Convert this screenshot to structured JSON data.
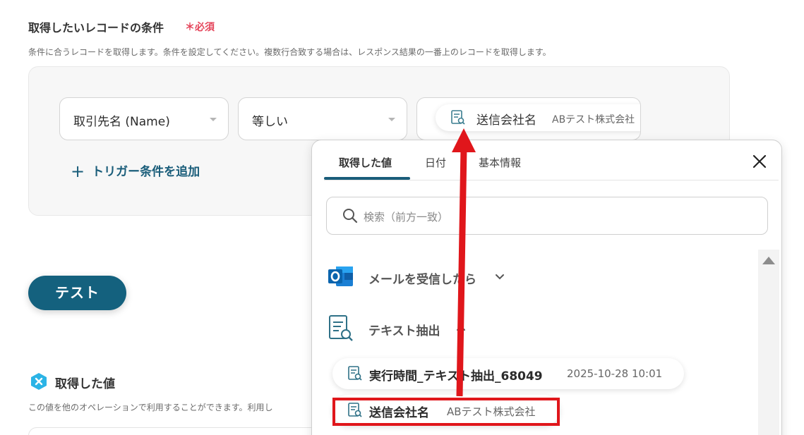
{
  "condition": {
    "title": "取得したいレコードの条件",
    "required_mark": "＊必須",
    "description": "条件に合うレコードを取得します。条件を設定してください。複数行合致する場合は、レスポンス結果の一番上のレコードを取得します。",
    "field_select": "取引先名 (Name)",
    "operator_select": "等しい",
    "value_chip": {
      "name": "送信会社名",
      "value": "ABテスト株式会社"
    },
    "add_condition_plus": "+",
    "add_condition_label": "トリガー条件を追加"
  },
  "test_button": "テスト",
  "acquired": {
    "title": "取得した値",
    "description": "この値を他のオペレーションで利用することができます。利用し"
  },
  "dropdown": {
    "tabs": [
      "取得した値",
      "日付",
      "基本情報"
    ],
    "active_tab": 0,
    "search_placeholder": "検索（前方一致）",
    "sections": [
      {
        "label": "メールを受信したら",
        "icon": "outlook-icon",
        "expanded": false
      },
      {
        "label": "テキスト抽出",
        "icon": "document-search-icon",
        "expanded": true
      }
    ],
    "items": [
      {
        "name": "実行時間_テキスト抽出_68049",
        "value": "2025-10-28 10:01"
      },
      {
        "name": "送信会社名",
        "value": "ABテスト株式会社"
      }
    ]
  },
  "colors": {
    "accent": "#14617e",
    "required": "#e5455b",
    "annotation": "#e0161b"
  }
}
